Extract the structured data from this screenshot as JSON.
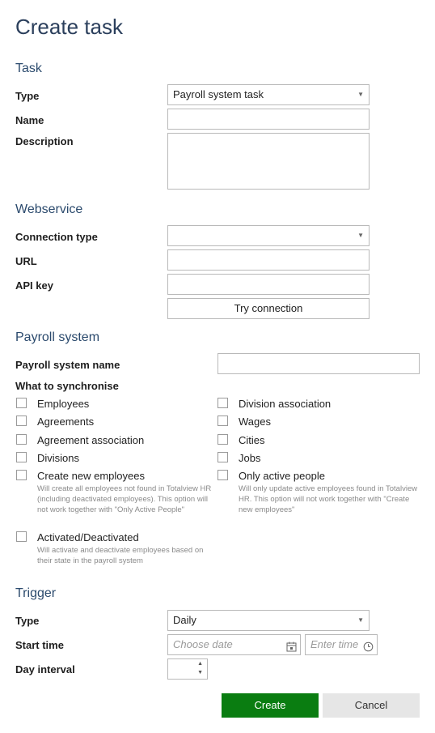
{
  "title": "Create task",
  "task": {
    "heading": "Task",
    "type_label": "Type",
    "type_value": "Payroll system task",
    "name_label": "Name",
    "description_label": "Description"
  },
  "webservice": {
    "heading": "Webservice",
    "connection_label": "Connection type",
    "url_label": "URL",
    "api_label": "API key",
    "try_button": "Try connection"
  },
  "payroll": {
    "heading": "Payroll system",
    "name_label": "Payroll system name",
    "sync_label": "What to synchronise",
    "left": [
      {
        "label": "Employees"
      },
      {
        "label": "Agreements"
      },
      {
        "label": "Agreement association"
      },
      {
        "label": "Divisions"
      },
      {
        "label": "Create new employees",
        "hint": "Will create all employees not found in Totalview HR (including deactivated employees). This option will not work together with \"Only Active People\""
      },
      {
        "label": "Activated/Deactivated",
        "hint": "Will activate and deactivate employees based on their state in the payroll system"
      }
    ],
    "right": [
      {
        "label": "Division association"
      },
      {
        "label": "Wages"
      },
      {
        "label": "Cities"
      },
      {
        "label": "Jobs"
      },
      {
        "label": "Only active people",
        "hint": "Will only update active employees found in Totalview HR. This option will not work together with \"Create new employees\""
      }
    ]
  },
  "trigger": {
    "heading": "Trigger",
    "type_label": "Type",
    "type_value": "Daily",
    "start_label": "Start time",
    "date_placeholder": "Choose date",
    "time_placeholder": "Enter time",
    "interval_label": "Day interval"
  },
  "actions": {
    "create": "Create",
    "cancel": "Cancel"
  }
}
